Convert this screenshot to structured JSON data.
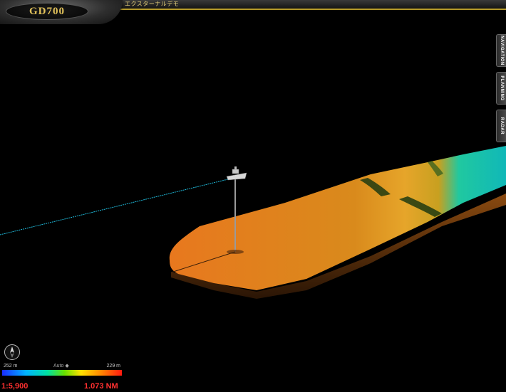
{
  "app": {
    "logo_text": "GD700",
    "title": "エクスターナルデモ"
  },
  "side_tabs": [
    {
      "label": "NAVIGATION"
    },
    {
      "label": "PLANNING"
    },
    {
      "label": "RADAR"
    }
  ],
  "depth_legend": {
    "min_label": "252 m",
    "max_label": "229 m",
    "mode_label": "Auto ◆"
  },
  "status": {
    "scale": "1:5,900",
    "range": "1.073 NM"
  },
  "colors": {
    "accent": "#b59a2a",
    "status_text": "#ff3030",
    "track_line": "#1fb8d8",
    "seabed_shallow": "#00c8a0",
    "seabed_deep": "#e87a20"
  },
  "icons": {
    "compass": "north-arrow-icon",
    "vessel": "ship-icon"
  }
}
